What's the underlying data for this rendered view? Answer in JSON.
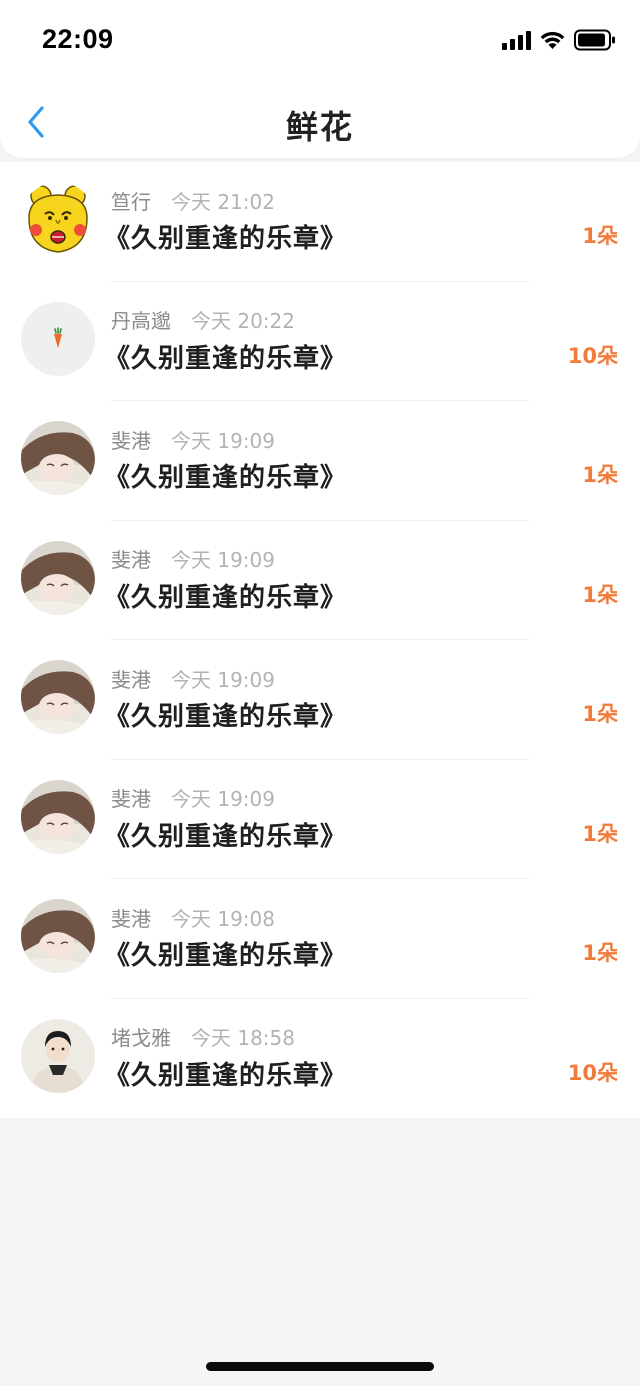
{
  "status_bar": {
    "time": "22:09"
  },
  "nav": {
    "title": "鲜花"
  },
  "colors": {
    "accent_blue": "#2e9bf0",
    "count_orange": "#f07b3a"
  },
  "items": [
    {
      "name": "笪行",
      "time": "今天 21:02",
      "title": "《久别重逢的乐章》",
      "count": "1朵",
      "avatar": "yellow-meme-avatar"
    },
    {
      "name": "丹高邈",
      "time": "今天 20:22",
      "title": "《久别重逢的乐章》",
      "count": "10朵",
      "avatar": "carrot-avatar"
    },
    {
      "name": "斐港",
      "time": "今天 19:09",
      "title": "《久别重逢的乐章》",
      "count": "1朵",
      "avatar": "girl-photo-avatar"
    },
    {
      "name": "斐港",
      "time": "今天 19:09",
      "title": "《久别重逢的乐章》",
      "count": "1朵",
      "avatar": "girl-photo-avatar"
    },
    {
      "name": "斐港",
      "time": "今天 19:09",
      "title": "《久别重逢的乐章》",
      "count": "1朵",
      "avatar": "girl-photo-avatar"
    },
    {
      "name": "斐港",
      "time": "今天 19:09",
      "title": "《久别重逢的乐章》",
      "count": "1朵",
      "avatar": "girl-photo-avatar"
    },
    {
      "name": "斐港",
      "time": "今天 19:08",
      "title": "《久别重逢的乐章》",
      "count": "1朵",
      "avatar": "girl-photo-avatar"
    },
    {
      "name": "堵戈雅",
      "time": "今天 18:58",
      "title": "《久别重逢的乐章》",
      "count": "10朵",
      "avatar": "child-photo-avatar"
    }
  ]
}
